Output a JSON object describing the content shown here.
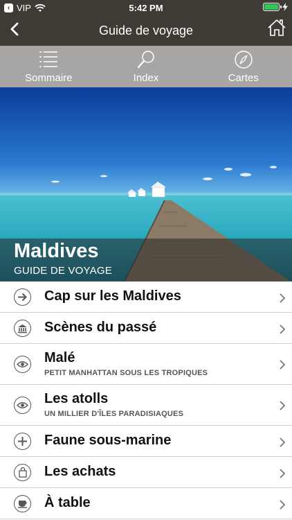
{
  "status_bar": {
    "carrier": "VIP",
    "time": "5:42 PM",
    "battery_color": "#33c759"
  },
  "navbar": {
    "title": "Guide de voyage",
    "back_icon": "chevron-left-icon",
    "home_icon": "home-icon"
  },
  "tabs": [
    {
      "label": "Sommaire",
      "icon": "list-icon"
    },
    {
      "label": "Index",
      "icon": "magnifier-icon"
    },
    {
      "label": "Cartes",
      "icon": "compass-icon"
    }
  ],
  "hero": {
    "title": "Maldives",
    "subtitle": "GUIDE DE VOYAGE"
  },
  "menu": [
    {
      "label": "Cap sur les Maldives",
      "sub": "",
      "icon": "arrow-right-icon"
    },
    {
      "label": "Scènes du passé",
      "sub": "",
      "icon": "museum-icon"
    },
    {
      "label": "Malé",
      "sub": "PETIT MANHATTAN SOUS LES TROPIQUES",
      "icon": "eye-icon"
    },
    {
      "label": "Les atolls",
      "sub": "UN MILLIER D'ÎLES PARADISIAQUES",
      "icon": "eye-icon"
    },
    {
      "label": "Faune sous-marine",
      "sub": "",
      "icon": "plus-icon"
    },
    {
      "label": "Les achats",
      "sub": "",
      "icon": "shopping-bag-icon"
    },
    {
      "label": "À table",
      "sub": "",
      "icon": "coffee-cup-icon"
    }
  ],
  "colors": {
    "header_bg": "#3f3a33",
    "tabbar_bg": "#a7a6a4",
    "caption_overlay": "rgba(40,40,40,0.55)"
  }
}
